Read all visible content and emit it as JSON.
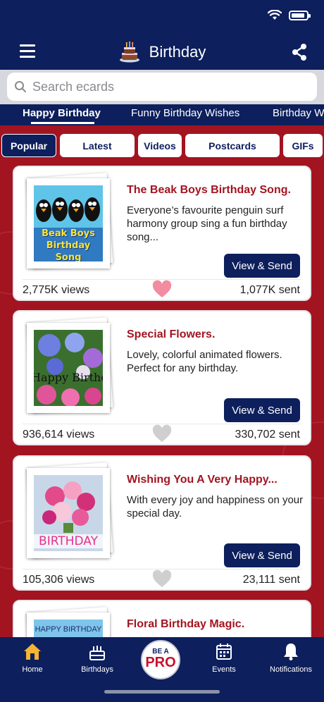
{
  "header": {
    "title": "Birthday"
  },
  "search": {
    "placeholder": "Search ecards"
  },
  "category_tabs": [
    {
      "label": "Happy Birthday",
      "active": true
    },
    {
      "label": "Funny Birthday Wishes",
      "active": false
    },
    {
      "label": "Birthday Wishes",
      "active": false
    }
  ],
  "filters": [
    {
      "label": "Popular",
      "active": true
    },
    {
      "label": "Latest",
      "active": false
    },
    {
      "label": "Videos",
      "active": false
    },
    {
      "label": "Postcards",
      "active": false
    },
    {
      "label": "GIFs",
      "active": false
    }
  ],
  "cards": [
    {
      "title": "The Beak Boys Birthday Song.",
      "description": "Everyone’s favourite penguin surf harmony group sing a fun birthday song...",
      "button": "View & Send",
      "views": "2,775K views",
      "sent": "1,077K sent",
      "favorited": true,
      "thumb_text": "Beak Boys Birthday Song"
    },
    {
      "title": "Special Flowers.",
      "description": "Lovely, colorful animated flowers. Perfect for any birthday.",
      "button": "View & Send",
      "views": "936,614 views",
      "sent": "330,702 sent",
      "favorited": false,
      "thumb_text": "Happy Birthday"
    },
    {
      "title": "Wishing You A Very Happy...",
      "description": "With every joy and happiness on your special day.",
      "button": "View & Send",
      "views": "105,306 views",
      "sent": "23,111 sent",
      "favorited": false,
      "thumb_text": "BIRTHDAY"
    },
    {
      "title": "Floral Birthday Magic.",
      "thumb_text": "HAPPY BIRTHDAY"
    }
  ],
  "tab_bar": {
    "home": "Home",
    "birthdays": "Birthdays",
    "pro_top": "BE A",
    "pro_bottom": "PRO",
    "events": "Events",
    "notifications": "Notifications"
  },
  "colors": {
    "navy": "#0d1f5c",
    "brand_red": "#a31421",
    "heart_pink": "#f28ca0"
  }
}
